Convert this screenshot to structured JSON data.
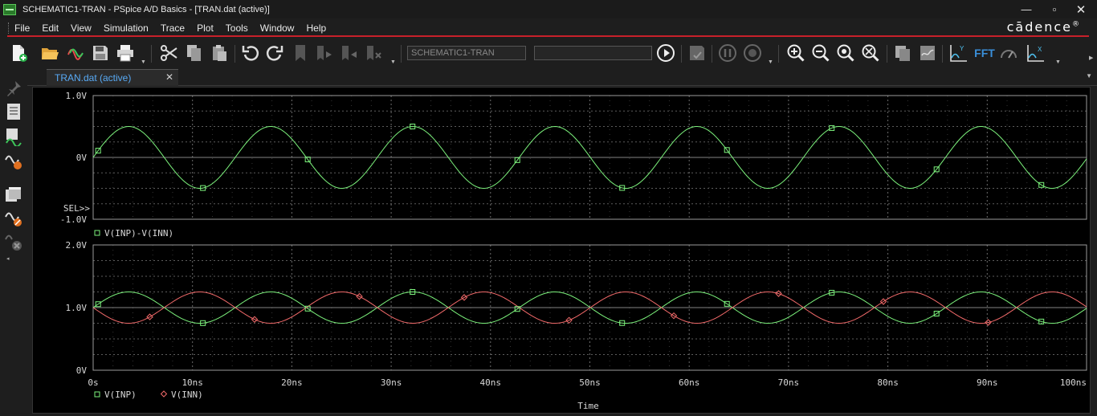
{
  "window": {
    "title": "SCHEMATIC1-TRAN - PSpice A/D Basics  - [TRAN.dat (active)]",
    "minimize": "—",
    "maximize": "▫",
    "close": "✕"
  },
  "menu": [
    "File",
    "Edit",
    "View",
    "Simulation",
    "Trace",
    "Plot",
    "Tools",
    "Window",
    "Help"
  ],
  "brand": "cādence",
  "brand_mark": "®",
  "toolbar": {
    "profile_value": "SCHEMATIC1-TRAN",
    "fft_label": "FFT",
    "icons": [
      "new-file-icon",
      "open-folder-icon",
      "waveform-icon",
      "save-icon",
      "print-icon",
      "cut-icon",
      "copy-icon",
      "paste-icon",
      "undo-icon",
      "redo-icon",
      "bookmark-icon",
      "next-marker-icon",
      "prev-marker-icon",
      "clear-marker-icon",
      "run-icon",
      "save-data-icon",
      "pause-icon",
      "stop-icon",
      "zoom-in-icon",
      "zoom-out-icon",
      "zoom-area-icon",
      "zoom-fit-icon",
      "copy-plot-icon",
      "plot-window-icon",
      "axis-y-icon",
      "fft-icon",
      "performance-icon",
      "axis-x-icon"
    ]
  },
  "tab": {
    "label": "TRAN.dat (active)",
    "close": "✕"
  },
  "colors": {
    "green_trace": "#7cf27c",
    "red_trace": "#f26a6a",
    "grid": "#9a9a9a",
    "axis_text": "#d8d8d8",
    "tab_text": "#58aaf5",
    "accent_red": "#c8202a"
  },
  "plot": {
    "sel_label": "SEL>>",
    "x_axis_title": "Time",
    "x_ticks": [
      "0s",
      "10ns",
      "20ns",
      "30ns",
      "40ns",
      "50ns",
      "60ns",
      "70ns",
      "80ns",
      "90ns",
      "100ns"
    ],
    "top_y_ticks": [
      "1.0V",
      "0V",
      "-1.0V"
    ],
    "bottom_y_ticks": [
      "2.0V",
      "1.0V",
      "0V"
    ],
    "top_legend": "V(INP)-V(INN)",
    "bottom_legend": [
      "V(INP)",
      "V(INN)"
    ]
  },
  "chart_data": [
    {
      "type": "line",
      "title": "",
      "xlabel": "Time",
      "ylabel": "",
      "xlim": [
        0,
        100
      ],
      "x_unit": "ns",
      "ylim": [
        -1.0,
        1.0
      ],
      "y_unit": "V",
      "grid": true,
      "legend": "bottom-left",
      "series": [
        {
          "name": "V(INP)-V(INN)",
          "color": "#7cf27c",
          "marker": "square",
          "amplitude": 0.5,
          "offset": 0.0,
          "period_ns": 14.3,
          "phase_deg": 0
        }
      ]
    },
    {
      "type": "line",
      "title": "",
      "xlabel": "Time",
      "ylabel": "",
      "xlim": [
        0,
        100
      ],
      "x_unit": "ns",
      "ylim": [
        0,
        2.0
      ],
      "y_unit": "V",
      "grid": true,
      "legend": "bottom-left",
      "series": [
        {
          "name": "V(INP)",
          "color": "#7cf27c",
          "marker": "square",
          "amplitude": 0.25,
          "offset": 1.0,
          "period_ns": 14.3,
          "phase_deg": 0
        },
        {
          "name": "V(INN)",
          "color": "#f26a6a",
          "marker": "diamond",
          "amplitude": 0.25,
          "offset": 1.0,
          "period_ns": 14.3,
          "phase_deg": 180
        }
      ]
    }
  ]
}
